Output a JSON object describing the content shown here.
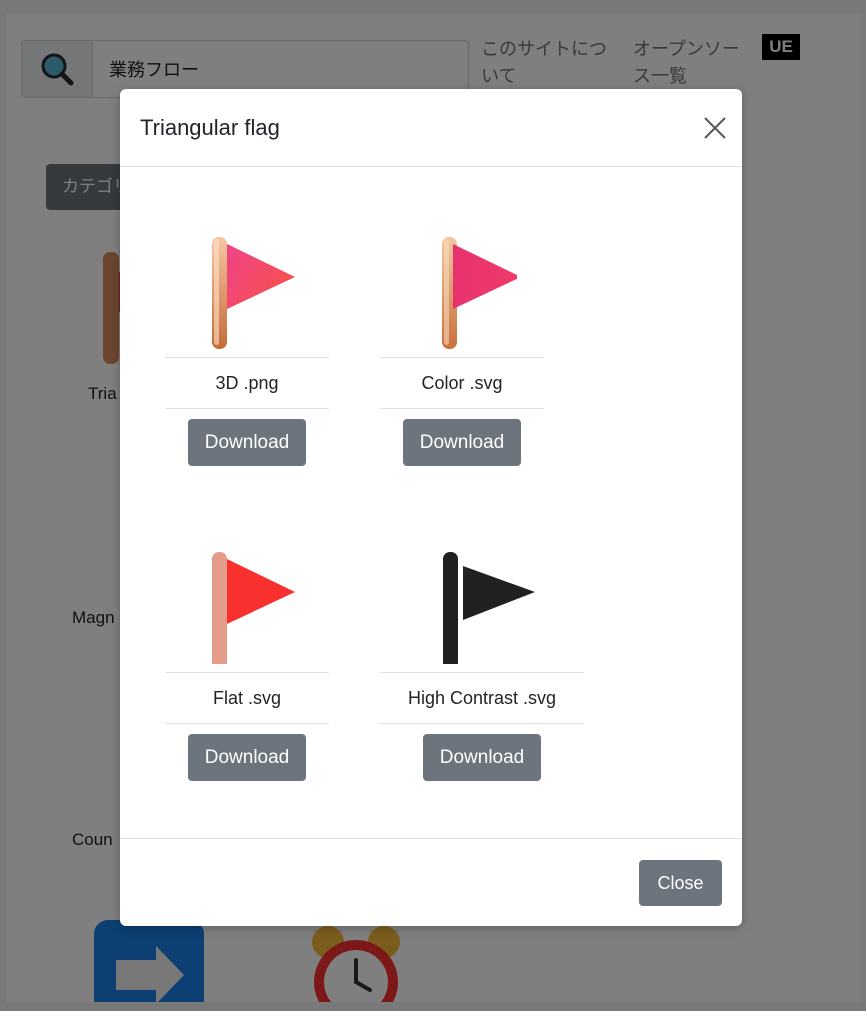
{
  "header": {
    "search_value": "業務フロー",
    "nav": [
      {
        "label": "このサイトについて"
      },
      {
        "label": "オープンソース一覧"
      }
    ],
    "logo_text": "UE"
  },
  "background": {
    "category_button": "カテゴリ",
    "card_labels": [
      "Tria",
      "Magn",
      "Coun"
    ]
  },
  "modal": {
    "title": "Triangular flag",
    "close_label": "Close",
    "variants": [
      {
        "name": "3D .png",
        "download_label": "Download",
        "style": "3d"
      },
      {
        "name": "Color .svg",
        "download_label": "Download",
        "style": "color"
      },
      {
        "name": "Flat .svg",
        "download_label": "Download",
        "style": "flat"
      },
      {
        "name": "High Contrast .svg",
        "download_label": "Download",
        "style": "high-contrast"
      }
    ]
  },
  "colors": {
    "button_gray": "#6c757d",
    "flag_pink": "#ee3d7a",
    "flag_red": "#f8312f",
    "flag_black": "#212121"
  }
}
